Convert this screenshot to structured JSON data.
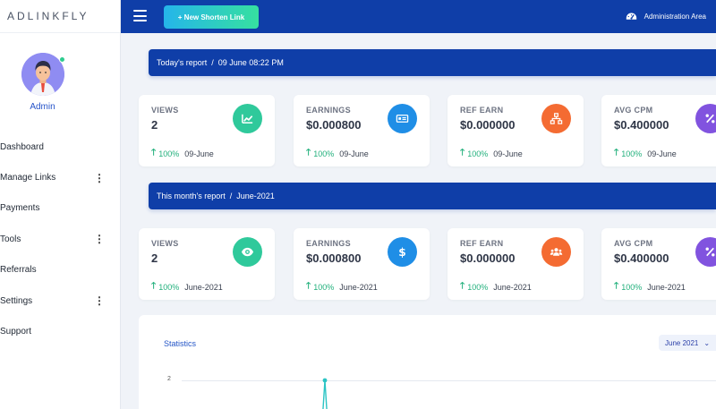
{
  "sidebar": {
    "logo": "ADLINKFLY",
    "user_name": "Admin",
    "items": [
      {
        "label": "Dashboard",
        "has_menu": false
      },
      {
        "label": "Manage Links",
        "has_menu": true
      },
      {
        "label": "Payments",
        "has_menu": false
      },
      {
        "label": "Tools",
        "has_menu": true
      },
      {
        "label": "Referrals",
        "has_menu": false
      },
      {
        "label": "Settings",
        "has_menu": true
      },
      {
        "label": "Support",
        "has_menu": false
      }
    ]
  },
  "topbar": {
    "new_link_label": "+ New Shorten Link",
    "admin_area_label": "Administration Area"
  },
  "today": {
    "label": "Today's report",
    "separator": "/",
    "date": "09 June 08:22 PM",
    "cards": [
      {
        "label": "VIEWS",
        "value": "2",
        "change": "100%",
        "period": "09-June",
        "icon": "chart-line-icon",
        "color": "#2fc99b"
      },
      {
        "label": "EARNINGS",
        "value": "$0.000800",
        "change": "100%",
        "period": "09-June",
        "icon": "money-bill-icon",
        "color": "#1f8ee6"
      },
      {
        "label": "REF EARN",
        "value": "$0.000000",
        "change": "100%",
        "period": "09-June",
        "icon": "sitemap-icon",
        "color": "#f46b32"
      },
      {
        "label": "AVG CPM",
        "value": "$0.400000",
        "change": "100%",
        "period": "09-June",
        "icon": "percent-icon",
        "color": "#8153df"
      }
    ]
  },
  "month": {
    "label": "This month's report",
    "separator": "/",
    "date": "June-2021",
    "cards": [
      {
        "label": "VIEWS",
        "value": "2",
        "change": "100%",
        "period": "June-2021",
        "icon": "eye-icon",
        "color": "#2fc99b"
      },
      {
        "label": "EARNINGS",
        "value": "$0.000800",
        "change": "100%",
        "period": "June-2021",
        "icon": "dollar-icon",
        "color": "#1f8ee6"
      },
      {
        "label": "REF EARN",
        "value": "$0.000000",
        "change": "100%",
        "period": "June-2021",
        "icon": "users-icon",
        "color": "#f46b32"
      },
      {
        "label": "AVG CPM",
        "value": "$0.400000",
        "change": "100%",
        "period": "June-2021",
        "icon": "percent-icon",
        "color": "#8153df"
      }
    ]
  },
  "statistics": {
    "title": "Statistics",
    "month_selected": "June 2021",
    "chart_data": {
      "type": "line",
      "y_ticks": [
        "2"
      ],
      "series": [
        {
          "values": [
            2
          ]
        }
      ]
    }
  }
}
